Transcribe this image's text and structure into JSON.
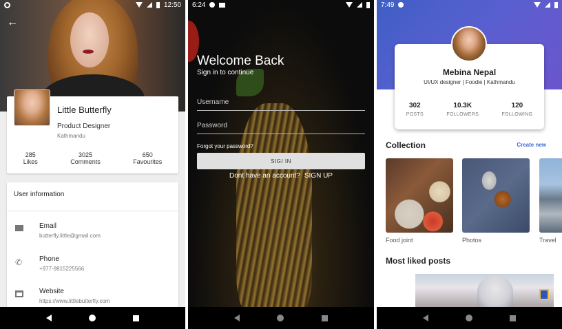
{
  "screen1": {
    "status": {
      "time": "12:50"
    },
    "profile": {
      "name": "Little Butterfly",
      "role": "Product Designer",
      "location": "Kathmandu",
      "stats": [
        {
          "value": "285",
          "label": "Likes"
        },
        {
          "value": "3025",
          "label": "Comments"
        },
        {
          "value": "650",
          "label": "Favourites"
        }
      ]
    },
    "user_info": {
      "title": "User information",
      "rows": [
        {
          "icon": "email-icon",
          "title": "Email",
          "value": "butterfly.little@gmail.com"
        },
        {
          "icon": "phone-icon",
          "title": "Phone",
          "value": "+977-9815225566"
        },
        {
          "icon": "web-icon",
          "title": "Website",
          "value": "https://www.littlebutterfly.com"
        }
      ]
    }
  },
  "screen2": {
    "status": {
      "time": "6:24"
    },
    "title": "Welcome Back",
    "subtitle": "Sign in to continue",
    "username_placeholder": "Username",
    "password_placeholder": "Password",
    "forgot": "Forgot your password?",
    "signin_button": "SIGI IN",
    "no_account": "Dont have an account?",
    "signup": "SIGN UP"
  },
  "screen3": {
    "status": {
      "time": "7:49"
    },
    "profile": {
      "name": "Mebina Nepal",
      "tagline": "UI/UX designer | Foodie | Kathmandu",
      "stats": [
        {
          "value": "302",
          "label": "POSTS"
        },
        {
          "value": "10.3K",
          "label": "FOLLOWERS"
        },
        {
          "value": "120",
          "label": "FOLLOWING"
        }
      ]
    },
    "collection_title": "Collection",
    "create_new": "Create new",
    "collections": [
      {
        "label": "Food joint"
      },
      {
        "label": "Photos"
      },
      {
        "label": "Travel"
      }
    ],
    "most_liked_title": "Most liked posts"
  }
}
